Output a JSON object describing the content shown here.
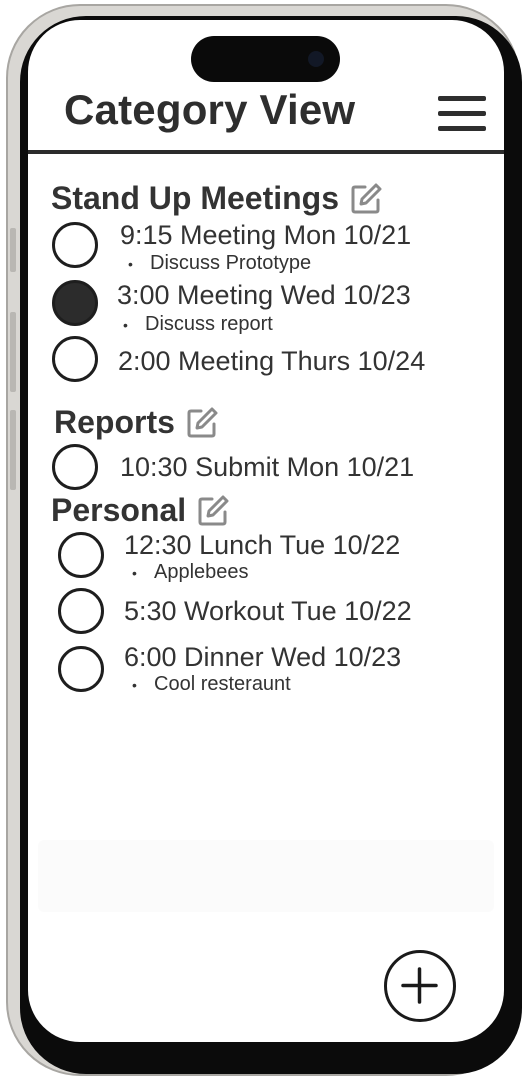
{
  "header": {
    "title": "Category View",
    "menu_icon": "hamburger-menu-icon"
  },
  "categories": [
    {
      "title": "Stand Up Meetings",
      "edit_icon": "edit-icon",
      "tasks": [
        {
          "text": "9:15 Meeting Mon 10/21",
          "note": "Discuss Prototype",
          "completed": false
        },
        {
          "text": "3:00 Meeting Wed 10/23",
          "note": "Discuss report",
          "completed": true
        },
        {
          "text": "2:00 Meeting Thurs 10/24",
          "note": "",
          "completed": false
        }
      ]
    },
    {
      "title": "Reports",
      "edit_icon": "edit-icon",
      "tasks": [
        {
          "text": "10:30 Submit Mon 10/21",
          "note": "",
          "completed": false
        }
      ]
    },
    {
      "title": "Personal",
      "edit_icon": "edit-icon",
      "tasks": [
        {
          "text": "12:30 Lunch Tue 10/22",
          "note": "Applebees",
          "completed": false
        },
        {
          "text": "5:30 Workout Tue 10/22",
          "note": "",
          "completed": false
        },
        {
          "text": "6:00 Dinner Wed 10/23",
          "note": "Cool resteraunt",
          "completed": false
        }
      ]
    }
  ],
  "fab": {
    "icon": "plus-icon"
  },
  "colors": {
    "completed_fill": "#2c2c2c",
    "text": "#333333",
    "edit_icon": "#8a8a8a",
    "divider": "#2b2b2b"
  }
}
